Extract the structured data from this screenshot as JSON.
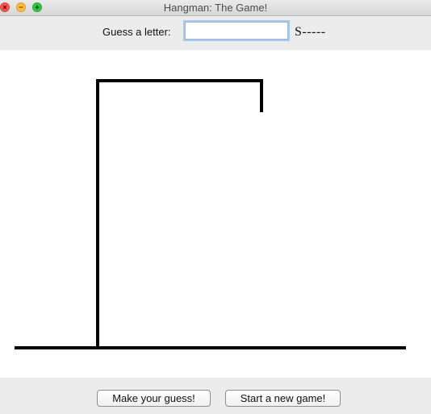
{
  "window": {
    "title": "Hangman: The Game!",
    "controls": [
      "close-icon",
      "minimize-icon",
      "maximize-icon"
    ]
  },
  "guess": {
    "label": "Guess a letter:",
    "value": "",
    "placeholder": ""
  },
  "word_display": "S-----",
  "drawing": {
    "parts_shown": [
      "ground",
      "post",
      "beam",
      "rope"
    ],
    "stroke_color": "#000000"
  },
  "buttons": {
    "make_guess": "Make your guess!",
    "new_game": "Start a new game!"
  }
}
